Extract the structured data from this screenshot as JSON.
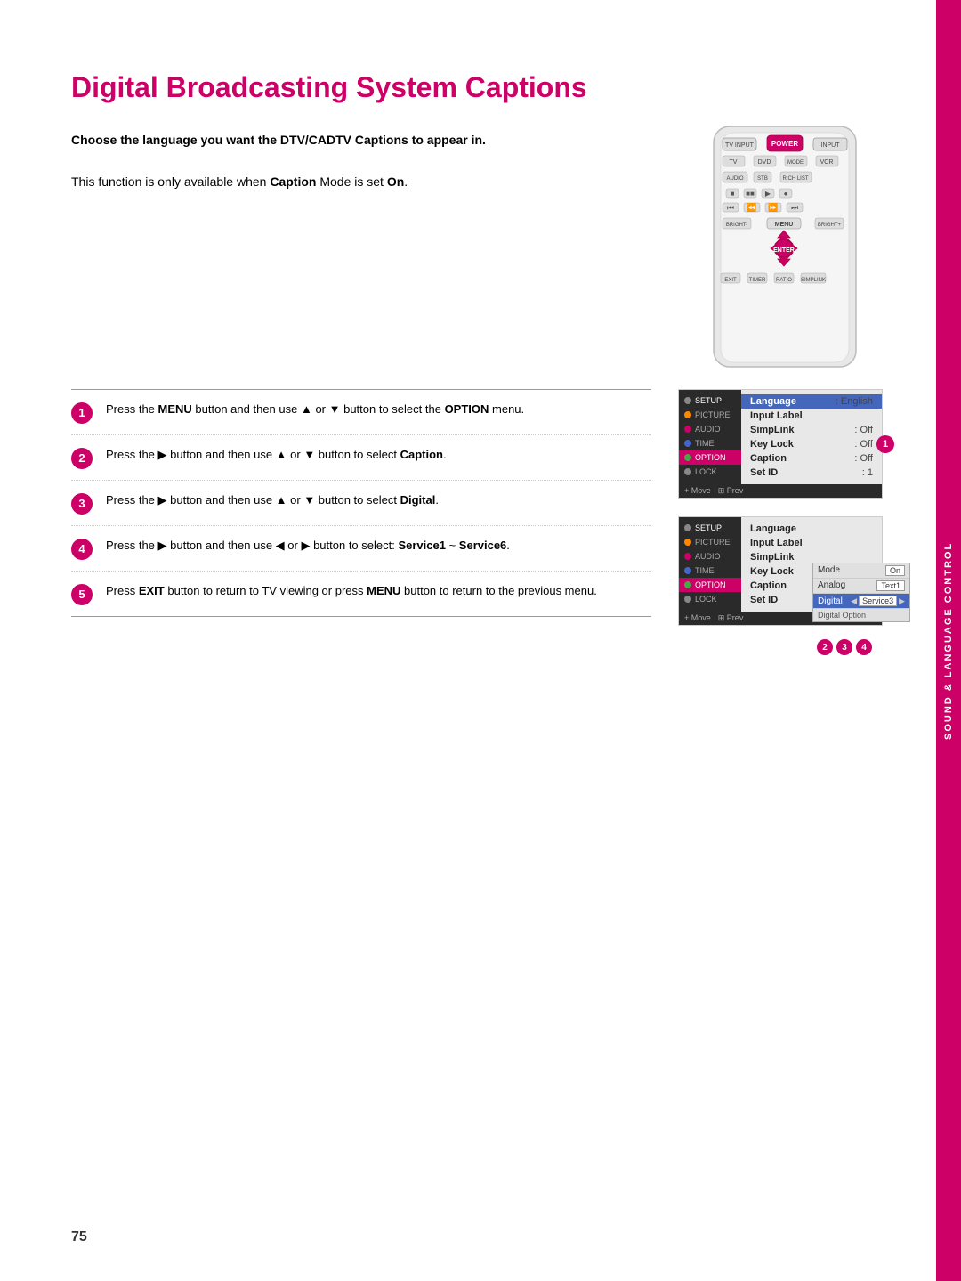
{
  "page": {
    "title": "Digital Broadcasting System Captions",
    "subtitle": "Choose the language you want the DTV/CADTV Captions to appear in.",
    "captionNote": {
      "part1": "This function is only available when ",
      "bold1": "Caption",
      "part2": " Mode is set ",
      "bold2": "On",
      "part3": "."
    },
    "sidebar_label": "SOUND & LANGUAGE CONTROL",
    "page_number": "75"
  },
  "steps": [
    {
      "number": "1",
      "text_parts": [
        "Press the ",
        "MENU",
        " button and then use ▲ or ▼ button to select the ",
        "OPTION",
        " menu."
      ]
    },
    {
      "number": "2",
      "text_parts": [
        "Press the ▶ button and then use ▲ or ▼ button to select ",
        "Caption",
        "."
      ]
    },
    {
      "number": "3",
      "text_parts": [
        "Press the ▶ button and then use ▲ or ▼ button to select ",
        "Digital",
        "."
      ]
    },
    {
      "number": "4",
      "text_parts": [
        "Press the ▶ button and then use ◀ or ▶ button to select: ",
        "Service1",
        " ~ ",
        "Service6",
        "."
      ]
    },
    {
      "number": "5",
      "text_parts": [
        "Press ",
        "EXIT",
        " button to return to TV viewing or press ",
        "MENU",
        " button to return to the previous menu."
      ]
    }
  ],
  "menu1": {
    "left_items": [
      {
        "label": "SETUP",
        "active": true,
        "iconColor": "gray"
      },
      {
        "label": "PICTURE",
        "active": false,
        "iconColor": "orange"
      },
      {
        "label": "AUDIO",
        "active": false,
        "iconColor": "pink"
      },
      {
        "label": "TIME",
        "active": false,
        "iconColor": "blue"
      },
      {
        "label": "OPTION",
        "active": false,
        "iconColor": "green",
        "highlighted": true
      },
      {
        "label": "LOCK",
        "active": false,
        "iconColor": "gray"
      }
    ],
    "right_rows": [
      {
        "label": "Language",
        "value": ": English",
        "highlighted": true
      },
      {
        "label": "Input Label",
        "value": ""
      },
      {
        "label": "SimpLink",
        "value": ": Off"
      },
      {
        "label": "Key Lock",
        "value": ": Off"
      },
      {
        "label": "Caption",
        "value": ": Off"
      },
      {
        "label": "Set ID",
        "value": ": 1"
      }
    ],
    "footer": "+ Move  OK Prev",
    "badge": "1"
  },
  "menu2": {
    "left_items": [
      {
        "label": "SETUP",
        "active": true,
        "iconColor": "gray"
      },
      {
        "label": "PICTURE",
        "active": false,
        "iconColor": "orange"
      },
      {
        "label": "AUDIO",
        "active": false,
        "iconColor": "pink"
      },
      {
        "label": "TIME",
        "active": false,
        "iconColor": "blue"
      },
      {
        "label": "OPTION",
        "active": false,
        "iconColor": "green",
        "highlighted": true
      },
      {
        "label": "LOCK",
        "active": false,
        "iconColor": "gray"
      }
    ],
    "right_rows": [
      {
        "label": "Language",
        "value": ""
      },
      {
        "label": "Input Label",
        "value": ""
      },
      {
        "label": "SimpLink",
        "value": ""
      },
      {
        "label": "Key Lock",
        "value": ""
      },
      {
        "label": "Caption",
        "value": "",
        "highlighted": true
      },
      {
        "label": "Set ID",
        "value": ""
      }
    ],
    "sub_options": [
      {
        "label": "Mode",
        "value": "On",
        "highlighted": false
      },
      {
        "label": "Analog",
        "value": "Text1",
        "highlighted": false
      },
      {
        "label": "Digital",
        "value": "Service3",
        "arrow": true,
        "highlighted": true
      },
      {
        "label": "Digital Option",
        "value": "",
        "highlighted": false
      }
    ],
    "footer": "+ Move  OK Prev",
    "badges": [
      "2",
      "3",
      "4"
    ]
  }
}
